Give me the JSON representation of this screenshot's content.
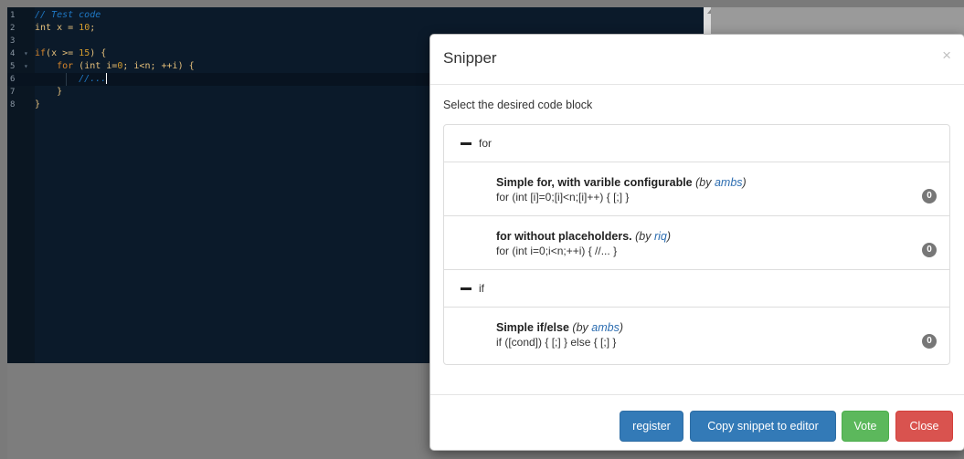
{
  "editor": {
    "lines": [
      {
        "n": "1",
        "fold": "",
        "parts": [
          {
            "t": "// Test code",
            "c": "c-comment"
          }
        ]
      },
      {
        "n": "2",
        "fold": "",
        "parts": [
          {
            "t": "int x = ",
            "c": "c-txt"
          },
          {
            "t": "10",
            "c": "c-num"
          },
          {
            "t": ";",
            "c": "c-txt"
          }
        ]
      },
      {
        "n": "3",
        "fold": "",
        "parts": []
      },
      {
        "n": "4",
        "fold": "▾",
        "parts": [
          {
            "t": "if",
            "c": "c-kw"
          },
          {
            "t": "(x >= ",
            "c": "c-txt"
          },
          {
            "t": "15",
            "c": "c-num"
          },
          {
            "t": ") {",
            "c": "c-txt"
          }
        ]
      },
      {
        "n": "5",
        "fold": "▾",
        "parts": [
          {
            "t": "    ",
            "c": "c-plain"
          },
          {
            "t": "for",
            "c": "c-kw"
          },
          {
            "t": " (int i=",
            "c": "c-txt"
          },
          {
            "t": "0",
            "c": "c-num"
          },
          {
            "t": "; i<n; ++i) {",
            "c": "c-txt"
          }
        ]
      },
      {
        "n": "6",
        "fold": "",
        "parts": [
          {
            "t": "        //...",
            "c": "c-comment"
          }
        ],
        "active": true
      },
      {
        "n": "7",
        "fold": "",
        "parts": [
          {
            "t": "    }",
            "c": "c-txt"
          }
        ]
      },
      {
        "n": "8",
        "fold": "",
        "parts": [
          {
            "t": "}",
            "c": "c-txt"
          }
        ]
      }
    ]
  },
  "modal": {
    "title": "Snipper",
    "close_glyph": "×",
    "instruction": "Select the desired code block",
    "groups": [
      {
        "label": "for",
        "snippets": [
          {
            "title": "Simple for, with varible configurable",
            "by": "by",
            "author": "ambs",
            "code": "for (int [i]=0;[i]<n;[i]++) { [;] }",
            "votes": "0"
          },
          {
            "title": "for without placeholders.",
            "by": "by",
            "author": "riq",
            "code": "for (int i=0;i<n;++i) { //... }",
            "votes": "0"
          }
        ]
      },
      {
        "label": "if",
        "snippets": [
          {
            "title": "Simple if/else",
            "by": "by",
            "author": "ambs",
            "code": "if ([cond]) { [;] } else { [;] }",
            "votes": "0"
          }
        ]
      }
    ],
    "buttons": {
      "register": "register",
      "copy": "Copy snippet to editor",
      "vote": "Vote",
      "close": "Close"
    }
  }
}
